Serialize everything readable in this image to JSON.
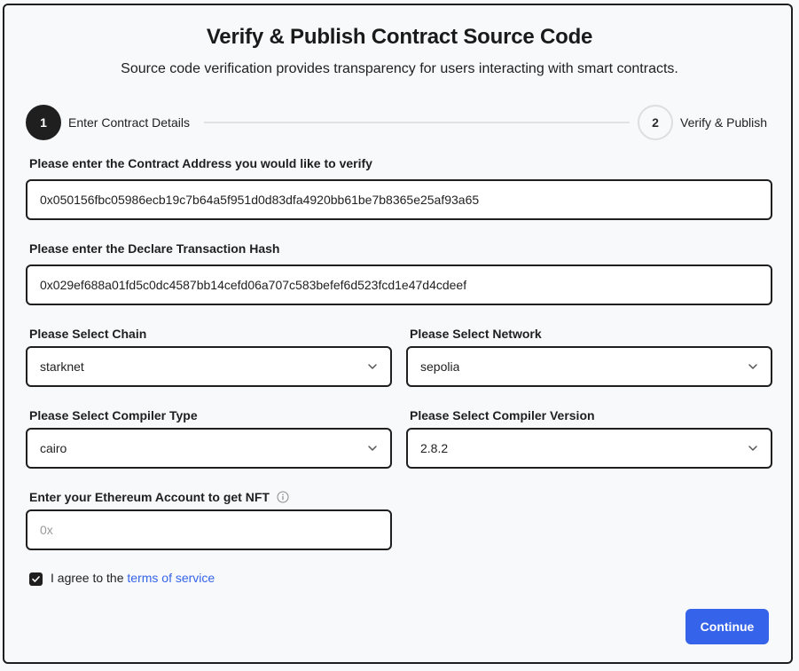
{
  "header": {
    "title": "Verify & Publish Contract Source Code",
    "subtitle": "Source code verification provides transparency for users interacting with smart contracts."
  },
  "stepper": {
    "steps": [
      {
        "number": "1",
        "label": "Enter Contract Details",
        "state": "active"
      },
      {
        "number": "2",
        "label": "Verify & Publish",
        "state": "inactive"
      }
    ]
  },
  "form": {
    "contract_address": {
      "label": "Please enter the Contract Address you would like to verify",
      "value": "0x050156fbc05986ecb19c7b64a5f951d0d83dfa4920bb61be7b8365e25af93a65"
    },
    "declare_hash": {
      "label": "Please enter the Declare Transaction Hash",
      "value": "0x029ef688a01fd5c0dc4587bb14cefd06a707c583befef6d523fcd1e47d4cdeef"
    },
    "chain": {
      "label": "Please Select Chain",
      "value": "starknet"
    },
    "network": {
      "label": "Please Select Network",
      "value": "sepolia"
    },
    "compiler_type": {
      "label": "Please Select Compiler Type",
      "value": "cairo"
    },
    "compiler_version": {
      "label": "Please Select Compiler Version",
      "value": "2.8.2"
    },
    "eth_account": {
      "label": "Enter your Ethereum Account to get NFT",
      "placeholder": "0x"
    },
    "agree": {
      "prefix": "I agree to the",
      "link": "terms of service",
      "checked": true
    }
  },
  "actions": {
    "continue_label": "Continue"
  },
  "colors": {
    "accent": "#3563e9",
    "dark": "#1f1f1f",
    "background": "#f8f9fa"
  }
}
